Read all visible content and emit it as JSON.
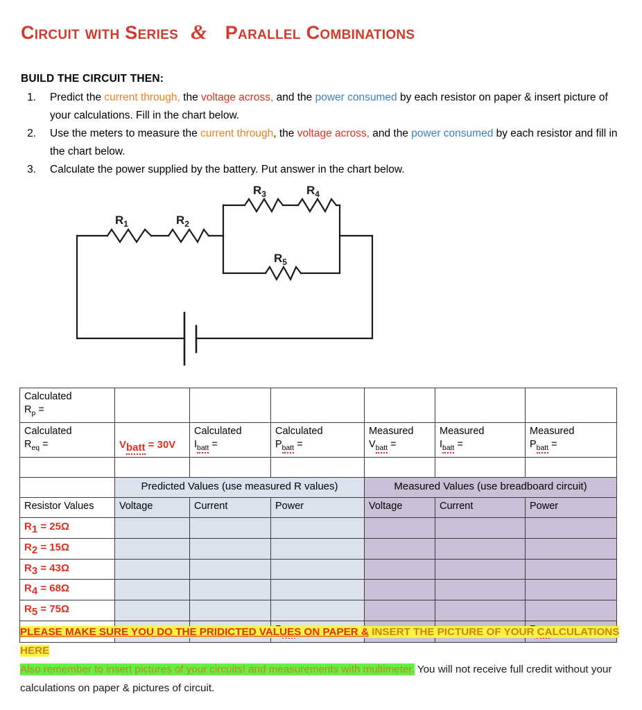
{
  "title": {
    "part1": "Circuit with Series",
    "amp": "&",
    "part2": "Parallel Combinations"
  },
  "instructions": {
    "lead": "BUILD THE CIRCUIT THEN:",
    "steps": [
      {
        "num": "1.",
        "seg1": "Predict the ",
        "hl_orange": "current through,",
        "seg2": " the ",
        "hl_red": "voltage across,",
        "seg3": " and the ",
        "hl_blue": "power consumed",
        "seg4": " by each resistor on paper & insert picture of your calculations. Fill in the chart below."
      },
      {
        "num": "2.",
        "seg1": "Use the meters to measure the ",
        "hl_orange": "current through",
        "seg2": ", the ",
        "hl_red": "voltage across,",
        "seg3": " and the ",
        "hl_blue": "power consumed",
        "seg4": " by each resistor and fill in the chart below."
      },
      {
        "num": "3.",
        "seg1": "Calculate the power supplied by the battery. Put answer in the chart below.",
        "hl_orange": "",
        "seg2": "",
        "hl_red": "",
        "seg3": "",
        "hl_blue": "",
        "seg4": ""
      }
    ]
  },
  "circuit": {
    "labels": {
      "r1": "R",
      "r1sub": "1",
      "r2": "R",
      "r2sub": "2",
      "r3": "R",
      "r3sub": "3",
      "r4": "R",
      "r4sub": "4",
      "r5": "R",
      "r5sub": "5"
    },
    "description": "Series resistors R1 and R2 feeding a parallel block of R3+R4 in series on the top branch and R5 on the bottom branch, returning to a battery"
  },
  "chart": {
    "row1": {
      "calculated_rp_line1": "Calculated",
      "calculated_rp_line2": "R",
      "calculated_rp_sub": "p",
      "calculated_rp_eq": " ="
    },
    "row2": {
      "req_line1": "Calculated",
      "req_line2": "R",
      "req_sub": "eq",
      "req_eq": " =",
      "vbatt": "V",
      "vbatt_sub": "batt",
      "vbatt_val": " = 30V",
      "ibatt_line1": "Calculated",
      "ibatt_line2": "I",
      "ibatt_sub": "batt",
      "ibatt_eq": " =",
      "pbatt_line1": "Calculated",
      "pbatt_line2": "P",
      "pbatt_sub": "batt",
      "pbatt_eq": " =",
      "mvbatt_line1": "Measured",
      "mvbatt_line2": "V",
      "mvbatt_sub": "batt",
      "mvbatt_eq": " =",
      "mibatt_line1": "Measured",
      "mibatt_line2": "I",
      "mibatt_sub": "batt",
      "mibatt_eq": " =",
      "mpbatt_line1": "Measured",
      "mpbatt_line2": "P",
      "mpbatt_sub": "batt",
      "mpbatt_eq": " ="
    },
    "group_headers": {
      "predicted": "Predicted Values (use measured R values)",
      "measured": "Measured Values (use breadboard circuit)"
    },
    "column_headers": {
      "resistor_values": "Resistor Values",
      "pred_voltage": "Voltage",
      "pred_current": "Current",
      "pred_power": "Power",
      "meas_voltage": "Voltage",
      "meas_current": "Current",
      "meas_power": "Power"
    },
    "resistors": [
      {
        "name": "R",
        "sub": "1",
        "value": " = 25Ω"
      },
      {
        "name": "R",
        "sub": "2",
        "value": " = 15Ω"
      },
      {
        "name": "R",
        "sub": "3",
        "value": " = 43Ω"
      },
      {
        "name": "R",
        "sub": "4",
        "value": " = 68Ω"
      },
      {
        "name": "R",
        "sub": "5",
        "value": " = 75Ω"
      }
    ],
    "total_row": {
      "ptotal": "P",
      "ptotal_sub": "total",
      "ptotal_eq": " ="
    }
  },
  "notes": {
    "line1_red": "PLEASE MAKE SURE YOU DO THE PRIDICTED VALUES ON PAPER &",
    "line1_orange": " INSERT THE PICTURE OF YOUR CALCULATIONS HERE",
    "line2_green": "Also remember to insert pictures of your circuits! and measurements with multimeter.",
    "line2_plain": " You will not receive full credit without your calculations on paper & pictures of circuit."
  },
  "colors": {
    "title_red": "#d23a2c",
    "orange": "#e8821e",
    "red": "#e02f21",
    "blue": "#3a7fc1",
    "predicted_cell": "#dbe2ee",
    "measured_cell": "#c9bfd6",
    "highlight_yellow": "#fff33f",
    "highlight_green": "#66ee44"
  }
}
